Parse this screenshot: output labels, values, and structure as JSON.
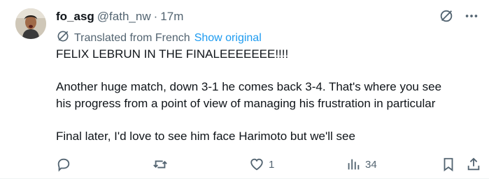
{
  "post": {
    "author": {
      "display_name": "fo_asg",
      "handle": "@fath_nw",
      "separator": "·",
      "time": "17m",
      "avatar_icon": "user-avatar"
    },
    "header_icons": [
      "grok-icon",
      "more-icon"
    ],
    "translation": {
      "icon": "translate-icon",
      "label": "Translated from French",
      "show_original": "Show original"
    },
    "text": {
      "line1": "FELIX LEBRUN IN THE FINALEEEEEEE!!!!",
      "line2": "Another huge match, down 3-1 he comes back 3-4. That's where you see",
      "line3": "his progress from a point of view of managing his frustration in particular",
      "line4": "Final later, I'd love to see him face Harimoto but we'll see"
    },
    "actions": {
      "reply": {
        "icon": "reply-icon",
        "count": ""
      },
      "repost": {
        "icon": "repost-icon",
        "count": ""
      },
      "like": {
        "icon": "heart-icon",
        "count": "1"
      },
      "views": {
        "icon": "views-icon",
        "count": "34"
      },
      "bookmark": {
        "icon": "bookmark-icon"
      },
      "share": {
        "icon": "share-icon"
      }
    },
    "colors": {
      "text_primary": "#0f1419",
      "text_secondary": "#536471",
      "link": "#1d9bf0"
    }
  }
}
